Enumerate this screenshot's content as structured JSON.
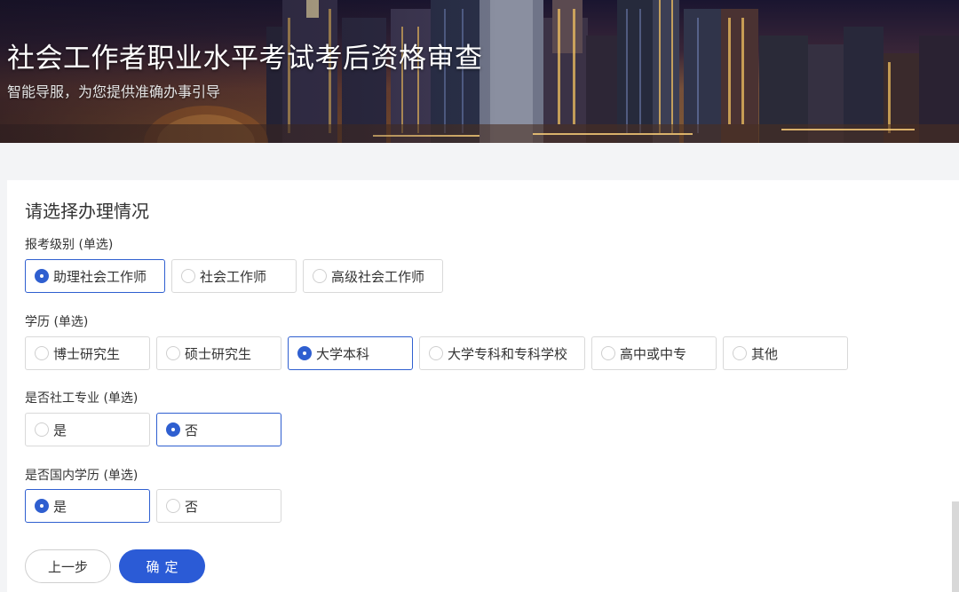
{
  "header": {
    "title": "社会工作者职业水平考试考后资格审查",
    "subtitle": "智能导服，为您提供准确办事引导"
  },
  "form": {
    "section_title": "请选择办理情况",
    "groups": [
      {
        "label": "报考级别 (单选)",
        "options": [
          {
            "label": "助理社会工作师",
            "selected": true
          },
          {
            "label": "社会工作师",
            "selected": false
          },
          {
            "label": "高级社会工作师",
            "selected": false
          }
        ]
      },
      {
        "label": "学历 (单选)",
        "options": [
          {
            "label": "博士研究生",
            "selected": false
          },
          {
            "label": "硕士研究生",
            "selected": false
          },
          {
            "label": "大学本科",
            "selected": true
          },
          {
            "label": "大学专科和专科学校",
            "selected": false
          },
          {
            "label": "高中或中专",
            "selected": false
          },
          {
            "label": "其他",
            "selected": false
          }
        ]
      },
      {
        "label": "是否社工专业 (单选)",
        "options": [
          {
            "label": "是",
            "selected": false
          },
          {
            "label": "否",
            "selected": true
          }
        ]
      },
      {
        "label": "是否国内学历 (单选)",
        "options": [
          {
            "label": "是",
            "selected": true
          },
          {
            "label": "否",
            "selected": false
          }
        ]
      }
    ]
  },
  "buttons": {
    "prev_label": "上一步",
    "confirm_label": "确定"
  },
  "colors": {
    "accent": "#2b5bd6",
    "selected_border": "#2f5fd0",
    "page_bg": "#f3f4f6"
  }
}
